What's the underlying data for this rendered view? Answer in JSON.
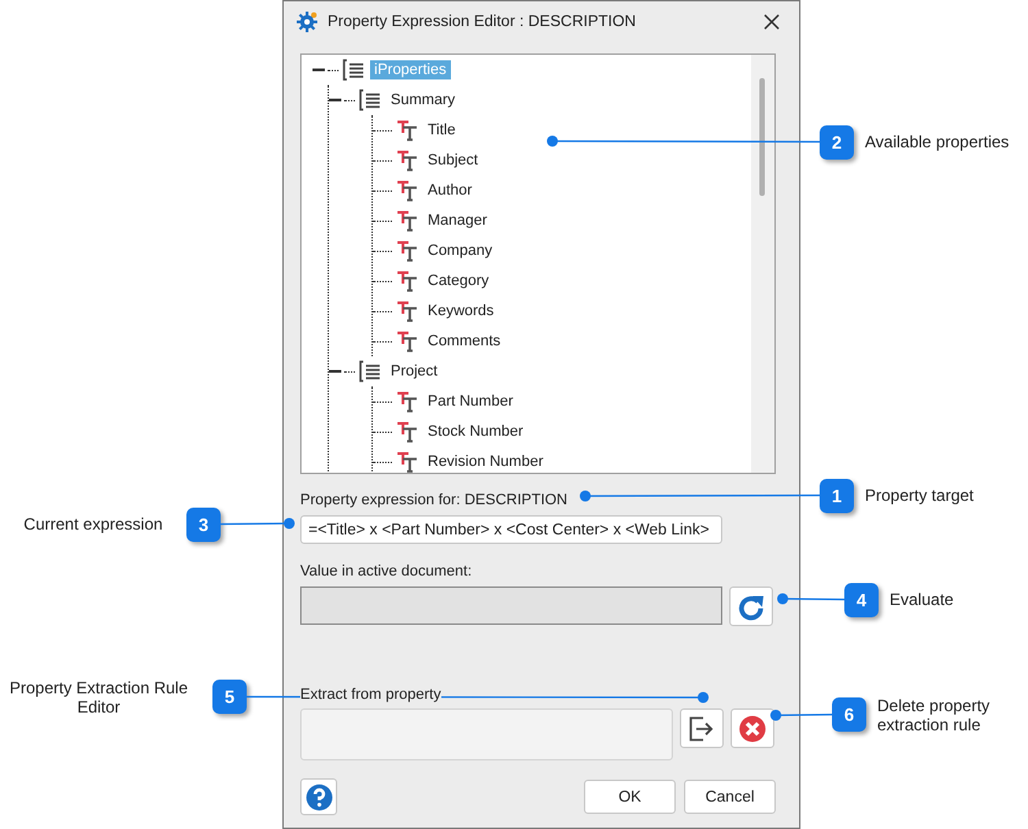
{
  "window": {
    "title": "Property Expression Editor : DESCRIPTION"
  },
  "tree": [
    {
      "label": "iProperties",
      "kind": "group",
      "expanded": true,
      "selected": true,
      "children": [
        {
          "label": "Summary",
          "kind": "group",
          "expanded": true,
          "selected": false,
          "children": [
            {
              "label": "Title",
              "kind": "property",
              "selected": false
            },
            {
              "label": "Subject",
              "kind": "property",
              "selected": false
            },
            {
              "label": "Author",
              "kind": "property",
              "selected": false
            },
            {
              "label": "Manager",
              "kind": "property",
              "selected": false
            },
            {
              "label": "Company",
              "kind": "property",
              "selected": false
            },
            {
              "label": "Category",
              "kind": "property",
              "selected": false
            },
            {
              "label": "Keywords",
              "kind": "property",
              "selected": false
            },
            {
              "label": "Comments",
              "kind": "property",
              "selected": false
            }
          ]
        },
        {
          "label": "Project",
          "kind": "group",
          "expanded": true,
          "selected": false,
          "children": [
            {
              "label": "Part Number",
              "kind": "property",
              "selected": false
            },
            {
              "label": "Stock Number",
              "kind": "property",
              "selected": false
            },
            {
              "label": "Revision Number",
              "kind": "property",
              "selected": false
            }
          ]
        }
      ]
    }
  ],
  "expression": {
    "label": "Property expression for: DESCRIPTION",
    "value": "=<Title> x <Part Number> x <Cost Center> x <Web Link>"
  },
  "active_value": {
    "label": "Value in active document:"
  },
  "extract": {
    "label": "Extract from property"
  },
  "buttons": [
    {
      "kind": "help"
    },
    {
      "kind": "ok",
      "label": "OK"
    },
    {
      "kind": "cancel",
      "label": "Cancel"
    }
  ],
  "callouts": [
    {
      "number": "2",
      "text": "Available properties"
    },
    {
      "number": "1",
      "text": "Property target"
    },
    {
      "number": "3",
      "text": "Current expression"
    },
    {
      "number": "4",
      "text": "Evaluate"
    },
    {
      "number": "5",
      "text": "Property Extraction Rule Editor"
    },
    {
      "number": "6",
      "text": "Delete property extraction rule"
    }
  ]
}
